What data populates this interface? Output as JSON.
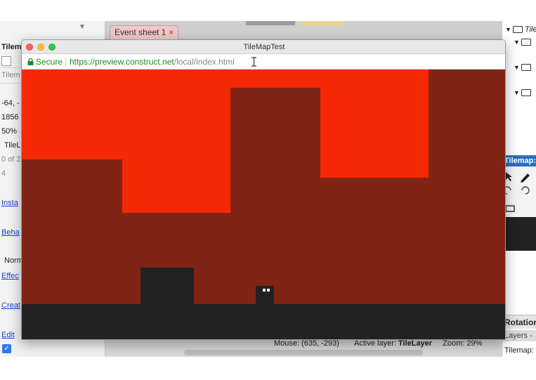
{
  "left_panel": {
    "rows": [
      {
        "text": "Tilem",
        "style": "bold"
      },
      {
        "text": "Tilem",
        "style": "grey"
      },
      {
        "text": "-64, -",
        "style": "normal"
      },
      {
        "text": "1856",
        "style": "normal"
      },
      {
        "text": "50%",
        "style": "normal"
      },
      {
        "text": "TileL",
        "style": "normal"
      },
      {
        "text": "0 of 2",
        "style": "grey"
      },
      {
        "text": "4",
        "style": "grey"
      },
      {
        "text": "Insta",
        "style": "link"
      },
      {
        "text": "Beha",
        "style": "link"
      },
      {
        "text": "Norm",
        "style": "normal"
      },
      {
        "text": "Effec",
        "style": "link"
      },
      {
        "text": "Creat",
        "style": "link"
      },
      {
        "text": "Edit",
        "style": "link"
      }
    ]
  },
  "editor": {
    "tab_label": "Event sheet 1",
    "tab_close": "×"
  },
  "browser": {
    "window_title": "TileMapTest",
    "secure_label": "Secure",
    "url_host": "https://preview.construct.net",
    "url_path": "/local/index.html"
  },
  "status_bar": {
    "mouse": "Mouse: (635, -293)",
    "active_layer_label": "Active layer: ",
    "active_layer_value": "TileLayer",
    "zoom": "Zoom: 29%"
  },
  "right_panel": {
    "root_label": "Tile",
    "tilemap_header": "Tilemap: T",
    "rotation_header": "Rotation",
    "layers_tab": "Layers -",
    "tilemap_tab": "Tilemap:"
  },
  "colors": {
    "sky": "#f52805",
    "wall": "#802415",
    "ground": "#222222",
    "secure_green": "#1e8a2e",
    "link_blue": "#1a3fd6"
  }
}
